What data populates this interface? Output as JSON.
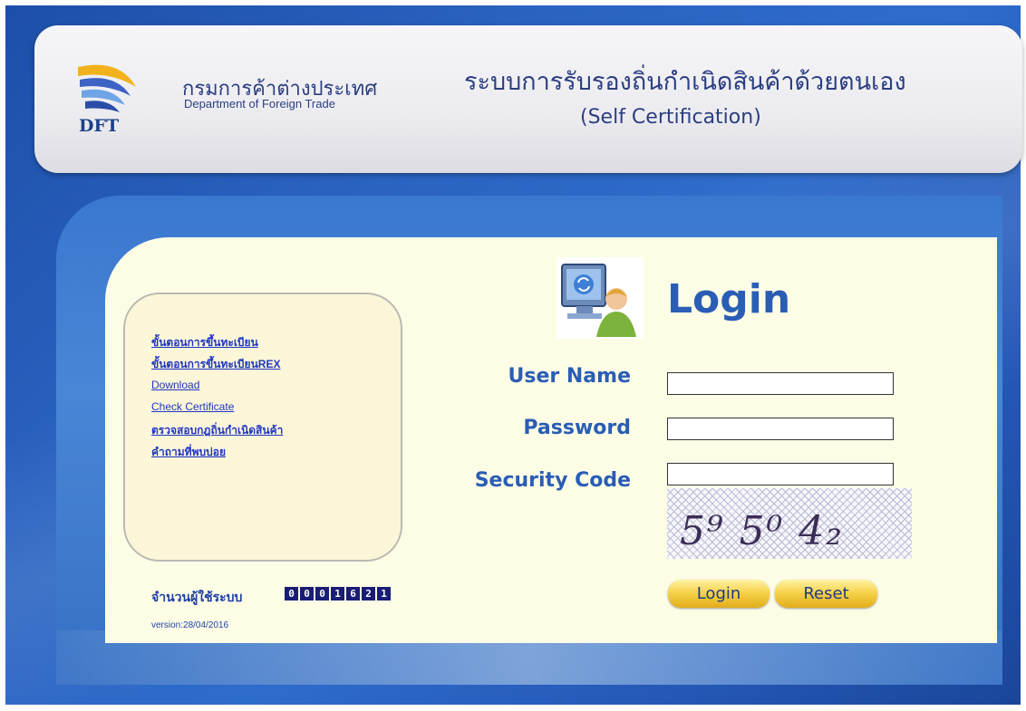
{
  "header": {
    "logo_text": "DFT",
    "org_name_th": "กรมการค้าต่างประเทศ",
    "org_name_en": "Department of Foreign Trade",
    "system_title_th": "ระบบการรับรองถิ่นกำเนิดสินค้าด้วยตนเอง",
    "system_title_en": "(Self Certification)"
  },
  "sidebar": {
    "links": [
      {
        "label": "ขั้นตอนการขึ้นทะเบียน"
      },
      {
        "label": "ขั้นตอนการขึ้นทะเบียนREX"
      },
      {
        "label": "Download"
      },
      {
        "label": "Check Certificate"
      },
      {
        "label": "ตรวจสอบกฎถิ่นกำเนิดสินค้า"
      },
      {
        "label": "คำถามที่พบบ่อย"
      }
    ],
    "counter_label": "จำนวนผู้ใช้ระบบ",
    "counter_digits": [
      "0",
      "0",
      "0",
      "1",
      "6",
      "2",
      "1"
    ],
    "version": "version:28/04/2016"
  },
  "login": {
    "title": "Login",
    "username_label": "User Name",
    "username_value": "",
    "password_label": "Password",
    "password_value": "",
    "security_label": "Security Code",
    "security_value": "",
    "captcha_text": "5⁹ 5⁰ 4₂",
    "login_button": "Login",
    "reset_button": "Reset"
  },
  "colors": {
    "background_blue": "#2a62c0",
    "panel_cream": "#fdfde6",
    "label_blue": "#2a5db5",
    "button_gold": "#f6d34d"
  }
}
